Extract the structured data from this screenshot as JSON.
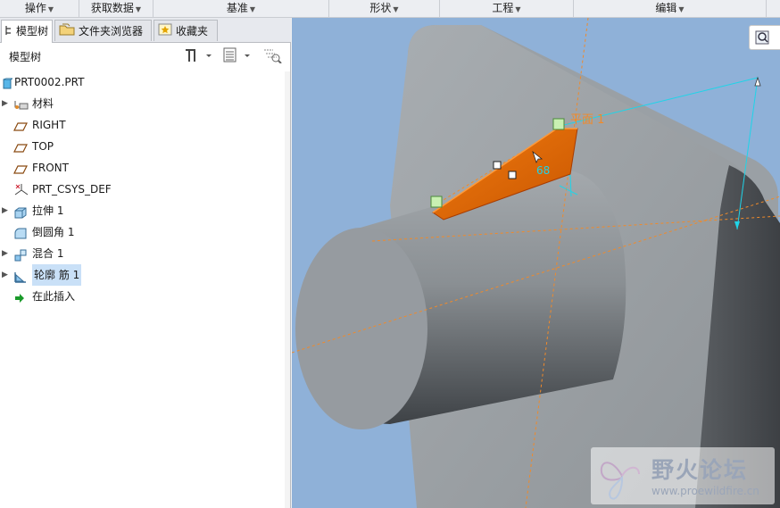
{
  "ribbon": {
    "groups": [
      {
        "label": "操作"
      },
      {
        "label": "获取数据"
      },
      {
        "label": "基准"
      },
      {
        "label": "形状"
      },
      {
        "label": "工程"
      },
      {
        "label": "编辑"
      }
    ]
  },
  "panel": {
    "tabs": [
      {
        "label": "模型树"
      },
      {
        "label": "文件夹浏览器"
      },
      {
        "label": "收藏夹"
      }
    ],
    "tree_title": "模型树",
    "tree": {
      "root": "PRT0002.PRT",
      "items": [
        {
          "label": "材料",
          "icon": "material-icon",
          "expandable": true
        },
        {
          "label": "RIGHT",
          "icon": "datum-plane-icon",
          "expandable": false
        },
        {
          "label": "TOP",
          "icon": "datum-plane-icon",
          "expandable": false
        },
        {
          "label": "FRONT",
          "icon": "datum-plane-icon",
          "expandable": false
        },
        {
          "label": "PRT_CSYS_DEF",
          "icon": "csys-icon",
          "expandable": false
        },
        {
          "label": "拉伸 1",
          "icon": "extrude-icon",
          "expandable": true
        },
        {
          "label": "倒圆角 1",
          "icon": "round-icon",
          "expandable": false
        },
        {
          "label": "混合 1",
          "icon": "blend-icon",
          "expandable": true
        },
        {
          "label": "轮廓 筋 1",
          "icon": "rib-icon",
          "expandable": true,
          "selected": true
        },
        {
          "label": "在此插入",
          "icon": "insert-here-icon",
          "expandable": false
        }
      ]
    }
  },
  "viewport": {
    "plane_label": "平面 1",
    "dimension": "68",
    "watermark": {
      "title": "野火论坛",
      "url": "www.proewildfire.cn"
    }
  },
  "colors": {
    "viewport_bg": "#8fb1d8",
    "rib_orange": "#e06a00",
    "datum_orange": "#f08a2a",
    "dim_cyan": "#1fd4e8",
    "selection": "#c9e0f7"
  }
}
